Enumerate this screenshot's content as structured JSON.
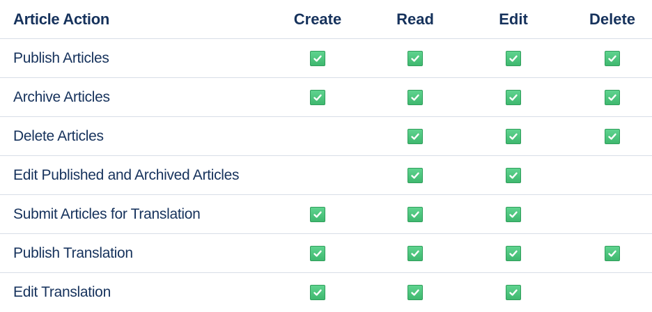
{
  "table": {
    "headers": {
      "action": "Article Action",
      "create": "Create",
      "read": "Read",
      "edit": "Edit",
      "delete": "Delete"
    },
    "rows": [
      {
        "action": "Publish Articles",
        "create": true,
        "read": true,
        "edit": true,
        "delete": true
      },
      {
        "action": "Archive Articles",
        "create": true,
        "read": true,
        "edit": true,
        "delete": true
      },
      {
        "action": "Delete Articles",
        "create": false,
        "read": true,
        "edit": true,
        "delete": true
      },
      {
        "action": "Edit Published and Archived Articles",
        "create": false,
        "read": true,
        "edit": true,
        "delete": false
      },
      {
        "action": "Submit Articles for Translation",
        "create": true,
        "read": true,
        "edit": true,
        "delete": false
      },
      {
        "action": "Publish Translation",
        "create": true,
        "read": true,
        "edit": true,
        "delete": true
      },
      {
        "action": "Edit Translation",
        "create": true,
        "read": true,
        "edit": true,
        "delete": false
      }
    ]
  },
  "colors": {
    "text": "#16325c",
    "check_fill": "#4bca81",
    "divider": "#d8dde6"
  },
  "icons": {
    "check": "checkbox-checked-icon"
  }
}
